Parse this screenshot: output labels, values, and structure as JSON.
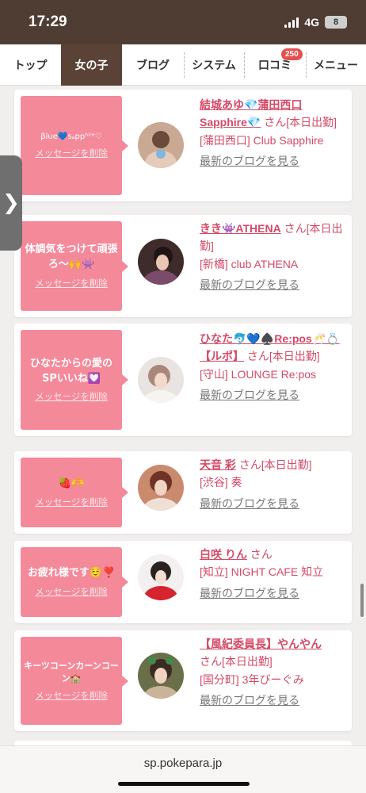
{
  "status_bar": {
    "time": "17:29",
    "network": "4G",
    "battery": "8"
  },
  "nav": {
    "tabs": [
      {
        "label": "トップ"
      },
      {
        "label": "女の子"
      },
      {
        "label": "ブログ"
      },
      {
        "label": "システム"
      },
      {
        "label": "口コミ",
        "badge": "250"
      },
      {
        "label": "メニュー"
      }
    ],
    "active_tab": "女の子"
  },
  "side_handle": {
    "icon": "chevron-right-icon",
    "glyph": "❯"
  },
  "delete_label": "メッセージを削除",
  "san_label": "さん",
  "blog_link_label": "最新のブログを見る",
  "messages": [
    {
      "message": "βlue💙sₐppʰⁱʳᵉ♡",
      "name": "結城あゆ💎蒲田西口Sapphire💎",
      "status": "[本日出勤]",
      "location": "[蒲田西口] Club Sapphire",
      "has_blog_link": true
    },
    {
      "message": "体調気をつけて頑張ろ〜🙌👾",
      "name": "きき👾ATHENA",
      "status": "[本日出勤]",
      "location": "[新橋] club ATHENA",
      "has_blog_link": true
    },
    {
      "message": "ひなたからの愛のSPいいね💟",
      "name": "ひなた🐬💙♠️Re:pos🥂💍【ルポ】",
      "status": "[本日出勤]",
      "location": "[守山] LOUNGE Re:pos",
      "has_blog_link": true
    },
    {
      "message": "🍓🫶",
      "name": "天音 彩",
      "status": "[本日出勤]",
      "location": "[渋谷] 奏",
      "has_blog_link": true
    },
    {
      "message": "お疲れ様です☺️❣️",
      "name": "白咲 りん",
      "status": "",
      "location": "[知立] NIGHT CAFE 知立",
      "has_blog_link": true
    },
    {
      "message": "キーツコーンカーンコーン🏫",
      "name": "【風紀委員長】やんやん",
      "status": "[本日出勤]",
      "location": "[国分町] 3年びーぐみ",
      "has_blog_link": true
    }
  ],
  "url_bar": {
    "url": "sp.pokepara.jp"
  },
  "colors": {
    "header_bg": "#4f3d34",
    "active_tab_bg": "#5a4336",
    "bubble": "#f4899a",
    "accent": "#d44a67",
    "badge": "#e4504f"
  }
}
